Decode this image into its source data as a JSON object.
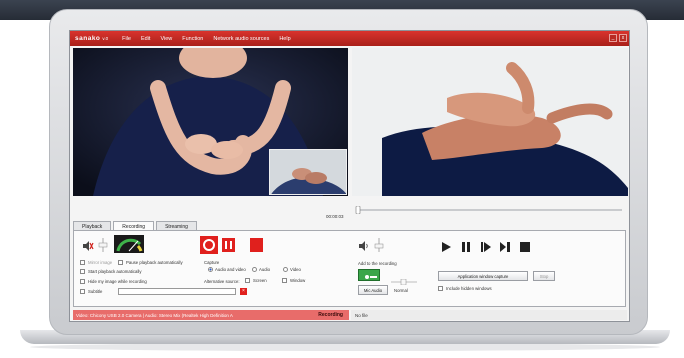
{
  "app": {
    "logo": "sanako",
    "version": "v.0",
    "menu": [
      "File",
      "Edit",
      "View",
      "Function",
      "Network audio sources",
      "Help"
    ]
  },
  "window_controls": {
    "minimize": "_",
    "close": "x"
  },
  "timeline": {
    "time": "00:00:03"
  },
  "tabs": [
    {
      "label": "Playback",
      "active": false
    },
    {
      "label": "Recording",
      "active": true
    },
    {
      "label": "Streaming",
      "active": false
    }
  ],
  "options": {
    "mirror_image": "Mirror image",
    "pause_playback": "Pause playback automatically",
    "start_playback": "Start playback automatically",
    "hide_image": "Hide my image while recording",
    "subtitle": "Subtitle"
  },
  "capture": {
    "title": "Capture",
    "choices": [
      {
        "label": "Audio and video",
        "selected": true
      },
      {
        "label": "Audio",
        "selected": false
      },
      {
        "label": "Video",
        "selected": false
      }
    ],
    "alt_source_label": "Alternative source:",
    "screen": "Screen",
    "window": "Window"
  },
  "add_to_recording": {
    "title": "Add to the recording",
    "mic_audio": "Mic Audio",
    "normal": "Normal",
    "app_capture": "Application window capture",
    "stop": "Stop",
    "include_hidden": "Include hidden windows"
  },
  "status": {
    "left": "Video: Chicony USB 2.0 Camera | Audio: Stereo Mix (Realtek High Definition A",
    "recording": "Recording",
    "right": "No file"
  },
  "colors": {
    "accent": "#c42a23",
    "record": "#e0201d",
    "green": "#3aa64a",
    "status_red": "#e86c6a"
  },
  "icons": {
    "speaker": "speaker-muted-icon",
    "gauge": "level-meter-icon",
    "record": "record-icon",
    "pause": "pause-icon",
    "stop": "stop-icon",
    "volume": "volume-icon",
    "play": "play-icon",
    "step_forward": "step-forward-icon",
    "fast_forward": "fast-forward-icon"
  }
}
